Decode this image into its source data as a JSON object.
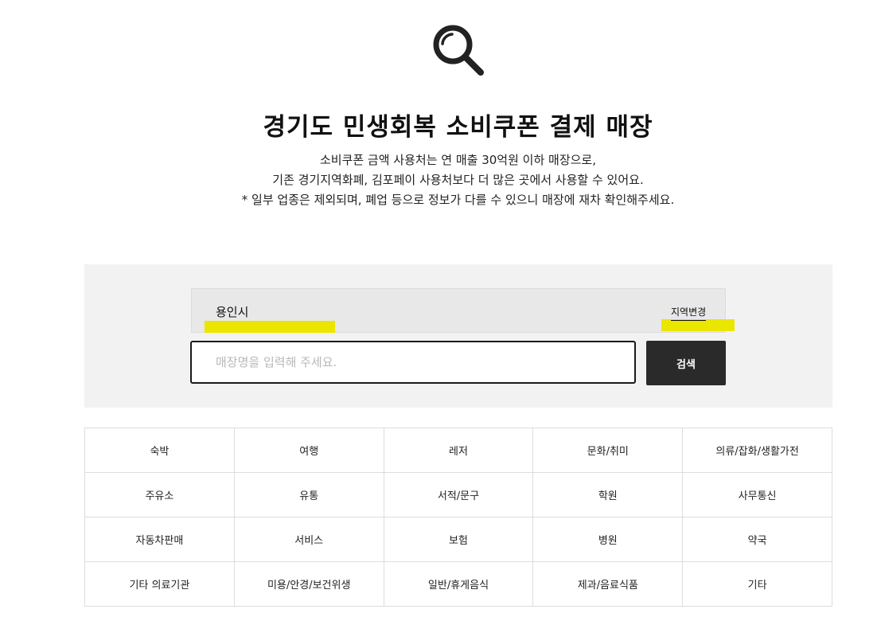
{
  "header": {
    "icon": "search-icon",
    "title": "경기도 민생회복 소비쿠폰 결제 매장",
    "description": [
      "소비쿠폰 금액 사용처는 연 매출 30억원 이하 매장으로,",
      "기존 경기지역화폐, 김포페이 사용처보다 더 많은 곳에서 사용할 수 있어요.",
      "* 일부 업종은 제외되며, 폐업 등으로 정보가 다를 수 있으니 매장에 재차 확인해주세요."
    ]
  },
  "search": {
    "region": "용인시",
    "change_region_label": "지역변경",
    "placeholder": "매장명을 입력해 주세요.",
    "value": "",
    "button_label": "검색",
    "highlight_color": "#ebe600"
  },
  "categories": [
    [
      "숙박",
      "여행",
      "레저",
      "문화/취미",
      "의류/잡화/생활가전"
    ],
    [
      "주유소",
      "유통",
      "서적/문구",
      "학원",
      "사무통신"
    ],
    [
      "자동차판매",
      "서비스",
      "보험",
      "병원",
      "약국"
    ],
    [
      "기타 의료기관",
      "미용/안경/보건위생",
      "일반/휴게음식",
      "제과/음료식품",
      "기타"
    ]
  ]
}
